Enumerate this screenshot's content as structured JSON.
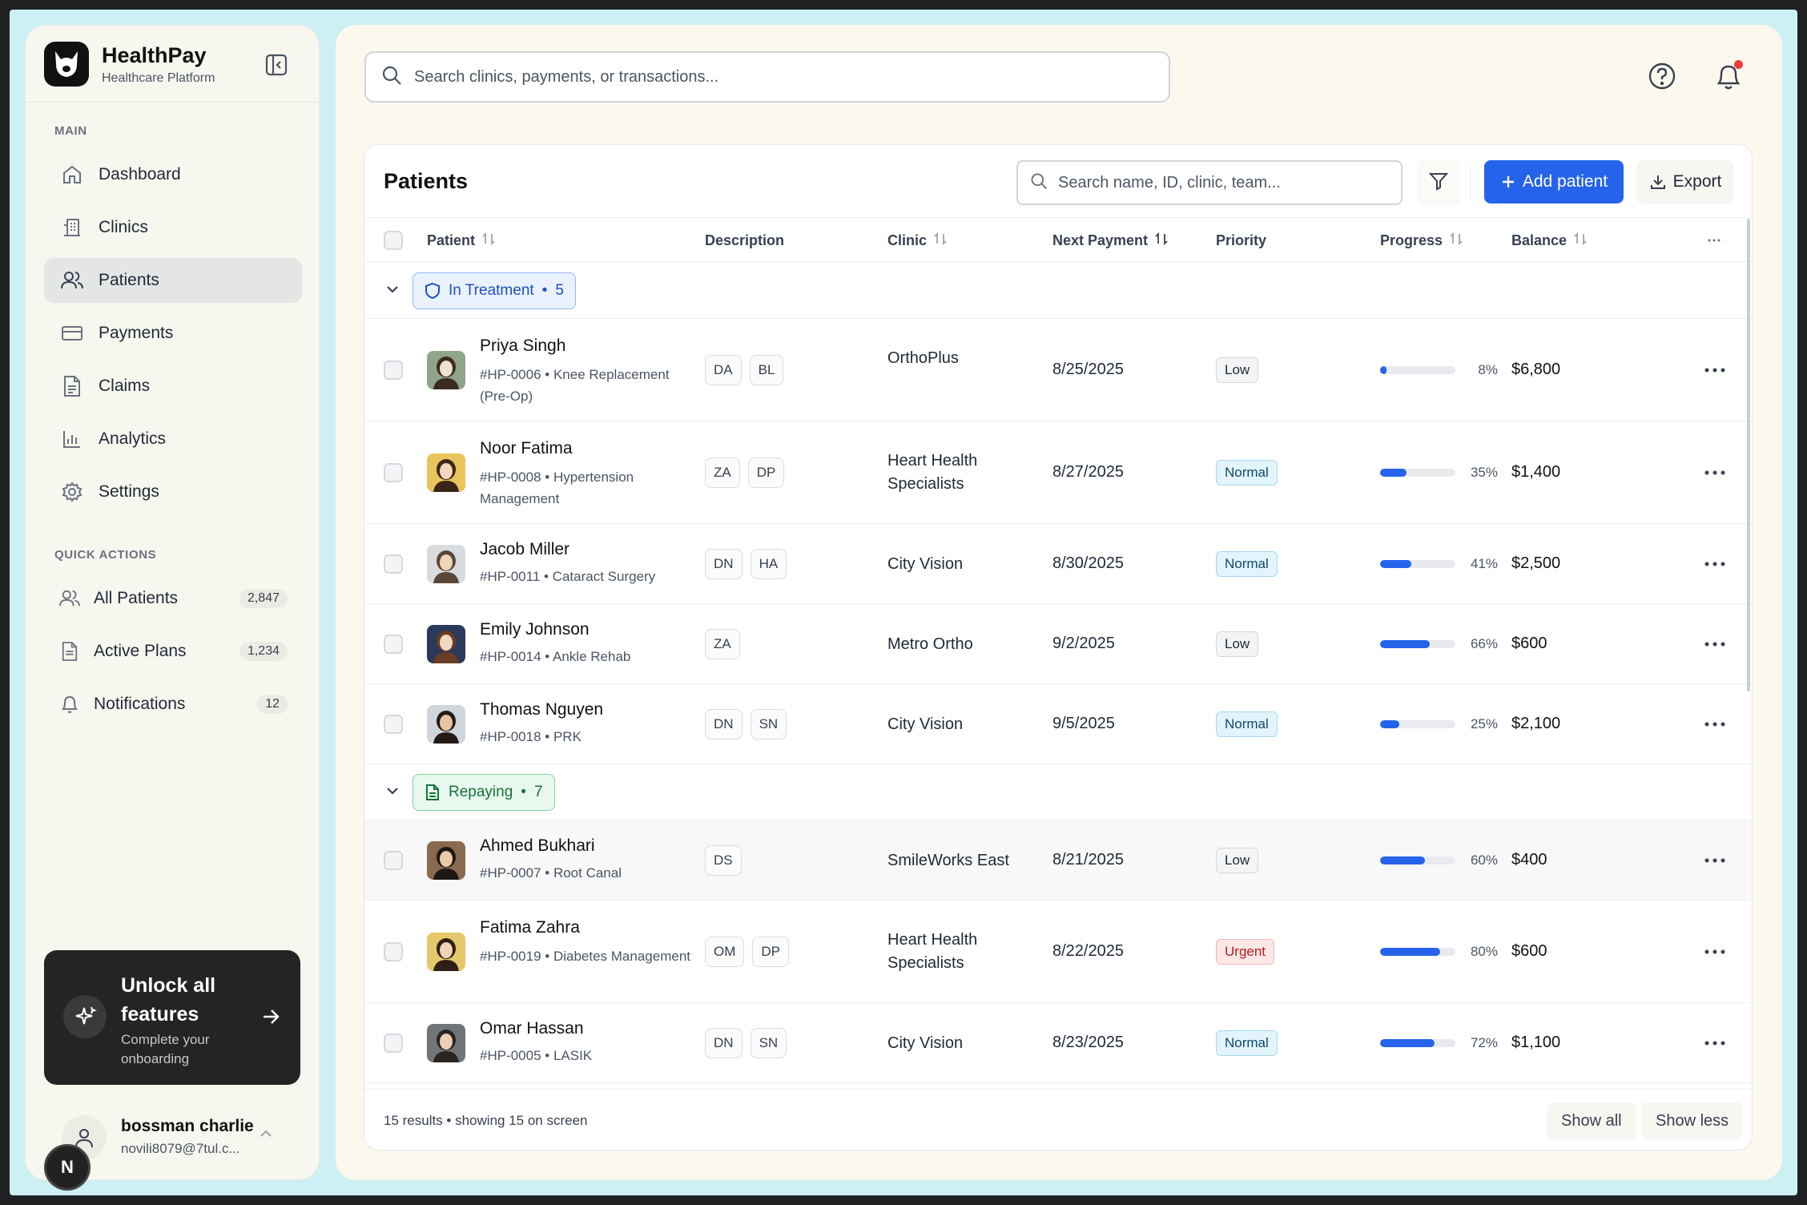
{
  "app": {
    "name": "HealthPay",
    "subtitle": "Healthcare Platform"
  },
  "sidebar": {
    "main_label": "MAIN",
    "items": [
      {
        "label": "Dashboard",
        "icon": "home-icon",
        "active": false
      },
      {
        "label": "Clinics",
        "icon": "building-icon",
        "active": false
      },
      {
        "label": "Patients",
        "icon": "users-icon",
        "active": true
      },
      {
        "label": "Payments",
        "icon": "credit-card-icon",
        "active": false
      },
      {
        "label": "Claims",
        "icon": "document-icon",
        "active": false
      },
      {
        "label": "Analytics",
        "icon": "bar-chart-icon",
        "active": false
      },
      {
        "label": "Settings",
        "icon": "gear-icon",
        "active": false
      }
    ],
    "quick_label": "QUICK ACTIONS",
    "quick": [
      {
        "label": "All Patients",
        "count": "2,847",
        "icon": "users-icon"
      },
      {
        "label": "Active Plans",
        "count": "1,234",
        "icon": "document-icon"
      },
      {
        "label": "Notifications",
        "count": "12",
        "icon": "bell-icon"
      }
    ],
    "unlock": {
      "title": "Unlock all features",
      "subtitle": "Complete your onboarding"
    },
    "user": {
      "name": "bossman charlie",
      "email": "novili8079@7tul.c...",
      "badge": "N"
    }
  },
  "topbar": {
    "search_placeholder": "Search clinics, payments, or transactions..."
  },
  "table": {
    "title": "Patients",
    "search_placeholder": "Search name, ID, clinic, team...",
    "add_label": "Add patient",
    "export_label": "Export",
    "columns": {
      "patient": "Patient",
      "description": "Description",
      "clinic": "Clinic",
      "next_payment": "Next Payment",
      "priority": "Priority",
      "progress": "Progress",
      "balance": "Balance"
    },
    "groups": [
      {
        "name": "In Treatment",
        "count": "5",
        "color": "#1e4fc2",
        "rows": [
          {
            "name": "Priya Singh",
            "meta": "#HP-0006 • Knee Replacement (Pre-Op)",
            "tags": [
              "DA",
              "BL"
            ],
            "clinic": "OrthoPlus",
            "next": "8/25/2025",
            "priority": "Low",
            "progress": 8,
            "progress_label": "8%",
            "balance": "$6,800"
          },
          {
            "name": "Noor Fatima",
            "meta": "#HP-0008 • Hypertension Management",
            "tags": [
              "ZA",
              "DP"
            ],
            "clinic": "Heart Health Specialists",
            "next": "8/27/2025",
            "priority": "Normal",
            "progress": 35,
            "progress_label": "35%",
            "balance": "$1,400"
          },
          {
            "name": "Jacob Miller",
            "meta": "#HP-0011 • Cataract Surgery",
            "tags": [
              "DN",
              "HA"
            ],
            "clinic": "City Vision",
            "next": "8/30/2025",
            "priority": "Normal",
            "progress": 41,
            "progress_label": "41%",
            "balance": "$2,500"
          },
          {
            "name": "Emily Johnson",
            "meta": "#HP-0014 • Ankle Rehab",
            "tags": [
              "ZA"
            ],
            "clinic": "Metro Ortho",
            "next": "9/2/2025",
            "priority": "Low",
            "progress": 66,
            "progress_label": "66%",
            "balance": "$600"
          },
          {
            "name": "Thomas Nguyen",
            "meta": "#HP-0018 • PRK",
            "tags": [
              "DN",
              "SN"
            ],
            "clinic": "City Vision",
            "next": "9/5/2025",
            "priority": "Normal",
            "progress": 25,
            "progress_label": "25%",
            "balance": "$2,100"
          }
        ]
      },
      {
        "name": "Repaying",
        "count": "7",
        "color": "#16733d",
        "rows": [
          {
            "name": "Ahmed Bukhari",
            "meta": "#HP-0007 • Root Canal",
            "tags": [
              "DS"
            ],
            "clinic": "SmileWorks East",
            "next": "8/21/2025",
            "priority": "Low",
            "progress": 60,
            "progress_label": "60%",
            "balance": "$400"
          },
          {
            "name": "Fatima Zahra",
            "meta": "#HP-0019 • Diabetes Management",
            "tags": [
              "OM",
              "DP"
            ],
            "clinic": "Heart Health Specialists",
            "next": "8/22/2025",
            "priority": "Urgent",
            "progress": 80,
            "progress_label": "80%",
            "balance": "$600"
          },
          {
            "name": "Omar Hassan",
            "meta": "#HP-0005 • LASIK",
            "tags": [
              "DN",
              "SN"
            ],
            "clinic": "City Vision",
            "next": "8/23/2025",
            "priority": "Normal",
            "progress": 72,
            "progress_label": "72%",
            "balance": "$1,100"
          }
        ]
      }
    ],
    "footer_text": "15 results • showing 15 on screen",
    "show_all": "Show all",
    "show_less": "Show less"
  }
}
